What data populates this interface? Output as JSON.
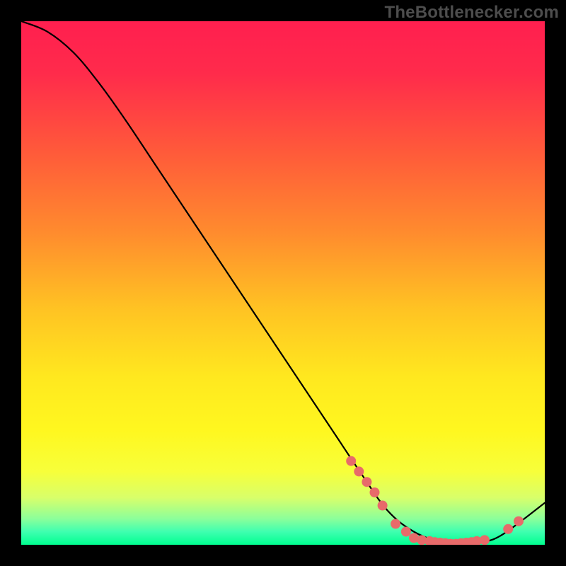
{
  "watermark": "TheBottlenecker.com",
  "chart_data": {
    "type": "line",
    "title": "",
    "xlabel": "",
    "ylabel": "",
    "xlim": [
      0,
      100
    ],
    "ylim": [
      0,
      100
    ],
    "gradient_stops": [
      {
        "offset": 0.0,
        "color": "#ff1f4f"
      },
      {
        "offset": 0.1,
        "color": "#ff2b4b"
      },
      {
        "offset": 0.25,
        "color": "#ff5a3a"
      },
      {
        "offset": 0.4,
        "color": "#ff8a2e"
      },
      {
        "offset": 0.55,
        "color": "#ffc323"
      },
      {
        "offset": 0.68,
        "color": "#ffe81f"
      },
      {
        "offset": 0.78,
        "color": "#fff71f"
      },
      {
        "offset": 0.86,
        "color": "#f7ff3a"
      },
      {
        "offset": 0.91,
        "color": "#d8ff6a"
      },
      {
        "offset": 0.95,
        "color": "#8cff9a"
      },
      {
        "offset": 0.975,
        "color": "#3fffb0"
      },
      {
        "offset": 1.0,
        "color": "#00ff90"
      }
    ],
    "series": [
      {
        "name": "curve",
        "color": "#000000",
        "x": [
          0,
          5,
          10,
          15,
          20,
          25,
          30,
          35,
          40,
          45,
          50,
          55,
          60,
          65,
          70,
          75,
          80,
          82,
          85,
          88,
          92,
          100
        ],
        "y": [
          100,
          98,
          94,
          88,
          81,
          73.5,
          66,
          58.5,
          51,
          43.5,
          36,
          28.5,
          21,
          13.5,
          6.5,
          2.5,
          0.5,
          0.2,
          0.2,
          0.5,
          2.0,
          8.0
        ]
      }
    ],
    "scatter": {
      "name": "dots",
      "color": "#e86a6a",
      "radius": 7,
      "points": [
        {
          "x": 63.0,
          "y": 16.0
        },
        {
          "x": 64.5,
          "y": 14.0
        },
        {
          "x": 66.0,
          "y": 12.0
        },
        {
          "x": 67.5,
          "y": 10.0
        },
        {
          "x": 69.0,
          "y": 7.5
        },
        {
          "x": 71.5,
          "y": 4.0
        },
        {
          "x": 73.5,
          "y": 2.5
        },
        {
          "x": 75.0,
          "y": 1.3
        },
        {
          "x": 76.5,
          "y": 0.9
        },
        {
          "x": 78.0,
          "y": 0.7
        },
        {
          "x": 79.0,
          "y": 0.5
        },
        {
          "x": 80.0,
          "y": 0.4
        },
        {
          "x": 81.0,
          "y": 0.3
        },
        {
          "x": 82.0,
          "y": 0.2
        },
        {
          "x": 83.0,
          "y": 0.2
        },
        {
          "x": 84.0,
          "y": 0.3
        },
        {
          "x": 85.0,
          "y": 0.4
        },
        {
          "x": 86.0,
          "y": 0.5
        },
        {
          "x": 87.0,
          "y": 0.7
        },
        {
          "x": 88.5,
          "y": 0.9
        },
        {
          "x": 93.0,
          "y": 3.0
        },
        {
          "x": 95.0,
          "y": 4.5
        }
      ]
    }
  }
}
